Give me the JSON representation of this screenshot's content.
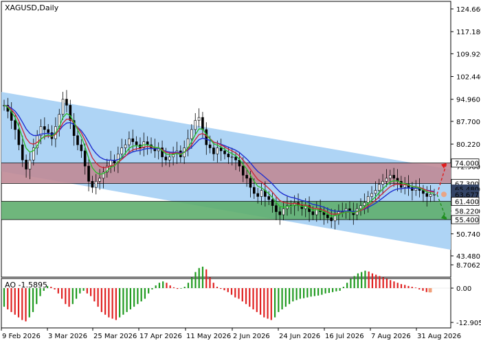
{
  "chart_data": {
    "type": "candlestick",
    "title": "XAGUSD,Daily",
    "indicator_title": "AO -1.5895",
    "x_tick_labels": [
      "9 Feb 2026",
      "3 Mar 2026",
      "25 Mar 2026",
      "17 Apr 2026",
      "11 May 2026",
      "2 Jun 2026",
      "24 Jun 2026",
      "16 Jul 2026",
      "7 Aug 2026",
      "31 Aug 2026"
    ],
    "y_tick_labels": [
      "124.660",
      "117.180",
      "109.920",
      "102.440",
      "94.960",
      "87.700",
      "80.220",
      "72.960",
      "65.480",
      "58.220",
      "50.740",
      "43.480"
    ],
    "ylim": [
      43.48,
      124.66
    ],
    "ao_tick_labels": [
      "8.7062",
      "0.00",
      "-12.9053"
    ],
    "ao_ylim": [
      -12.9053,
      8.7062
    ],
    "price_tags": [
      {
        "label": "74.000",
        "value": 74.0,
        "style": "boxed"
      },
      {
        "label": "67.300",
        "value": 67.3,
        "style": "boxed"
      },
      {
        "label": "65.480",
        "value": 65.48,
        "style": "dark"
      },
      {
        "label": "63.677",
        "value": 63.677,
        "style": "dark"
      },
      {
        "label": "61.400",
        "value": 61.4,
        "style": "boxed"
      },
      {
        "label": "58.220",
        "value": 58.22,
        "style": "plain"
      },
      {
        "label": "55.400",
        "value": 55.4,
        "style": "boxed"
      }
    ],
    "zones": [
      {
        "name": "resistance",
        "from": 67.3,
        "to": 74.0,
        "color": "#c08a96"
      },
      {
        "name": "support",
        "from": 55.4,
        "to": 61.4,
        "color": "#5fae6e"
      }
    ],
    "channel": {
      "upper_start": 98.5,
      "upper_end": 73.0,
      "lower_start": 69.0,
      "lower_end": 45.5,
      "color": "#aed4f5"
    },
    "forecast": {
      "up_target": 74.0,
      "down_target": 55.4
    },
    "series_colors": {
      "fast_ma": "#2ebd2e",
      "mid_ma": "#cc2b3b",
      "slow_ma": "#1f2fcf",
      "ao_up": "#1f9a1f",
      "ao_down": "#e02020"
    },
    "close": [
      93,
      91,
      88,
      85,
      80,
      75,
      72,
      75,
      79,
      83,
      86,
      85,
      84,
      82,
      86,
      90,
      95,
      93,
      88,
      83,
      80,
      78,
      73,
      68,
      66,
      68,
      69,
      71,
      73,
      75,
      74,
      77,
      79,
      80,
      82,
      81,
      80,
      79,
      81,
      80,
      79,
      78,
      79,
      76,
      75,
      76,
      77,
      78,
      76,
      79,
      82,
      85,
      88,
      89,
      85,
      80,
      79,
      77,
      79,
      78,
      77,
      76,
      76,
      75,
      73,
      70,
      69,
      66,
      64,
      63,
      65,
      63,
      62,
      60,
      58,
      57,
      59,
      60,
      60,
      61,
      60,
      59,
      60,
      58,
      57,
      59,
      58,
      57,
      56,
      55,
      57,
      58,
      58,
      59,
      58,
      57,
      59,
      60,
      61,
      63,
      64,
      65,
      67,
      68,
      69,
      70,
      69,
      68,
      66,
      67,
      66,
      65,
      66,
      65,
      64,
      63,
      63.7,
      63.7
    ],
    "ao": [
      -7,
      -8,
      -9,
      -10,
      -11,
      -12,
      -12.5,
      -11,
      -9,
      -6,
      -3,
      -1,
      0.8,
      0.5,
      -0.5,
      -2,
      -4,
      -6,
      -7,
      -6,
      -4,
      -2,
      -1,
      -2,
      -3,
      -5,
      -7,
      -9,
      -10,
      -11,
      -11.5,
      -12,
      -11,
      -10,
      -9,
      -8,
      -7,
      -6,
      -5,
      -4,
      -2,
      -0.5,
      1,
      2,
      2.5,
      2,
      1,
      0.3,
      -0.3,
      -0.2,
      0.5,
      2,
      4,
      6,
      7.5,
      8,
      7,
      4,
      2,
      0.5,
      -0.3,
      -0.8,
      -1.5,
      -2.5,
      -3.5,
      -4,
      -5,
      -6,
      -7,
      -8,
      -9,
      -10,
      -11,
      -11.5,
      -12,
      -11,
      -9,
      -8,
      -7,
      -6,
      -5,
      -4.5,
      -4,
      -3.8,
      -3.5,
      -3.2,
      -3,
      -2.8,
      -2.5,
      -2,
      -1.8,
      -1.5,
      -1.2,
      -1,
      0.5,
      2,
      3.5,
      4.5,
      5.5,
      6,
      6.5,
      6.2,
      5.5,
      5,
      4.5,
      4,
      3.5,
      3,
      2.5,
      2,
      1.5,
      1.2,
      0.8,
      0.5,
      0.2,
      -0.5,
      -1,
      -1.5,
      -1.5895
    ]
  }
}
